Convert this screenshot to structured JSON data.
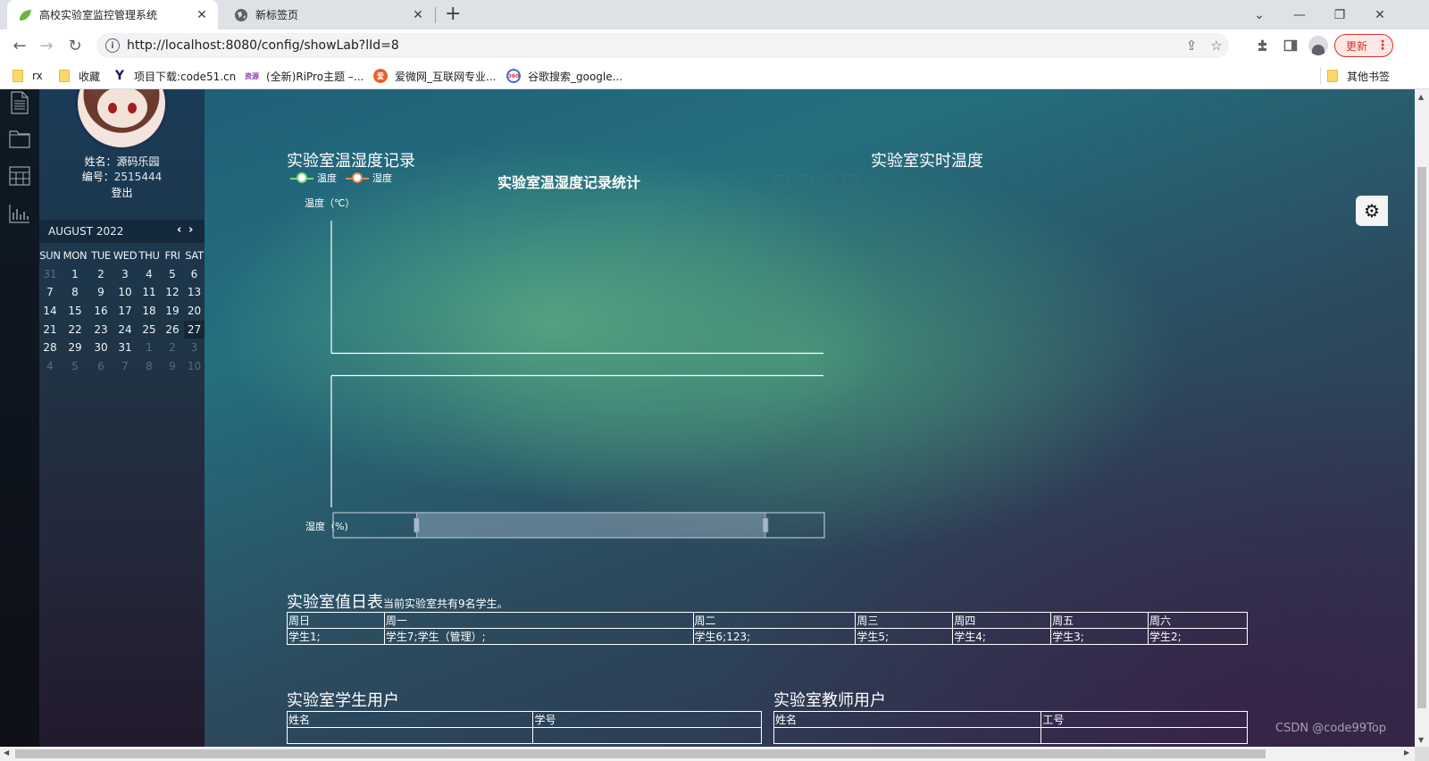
{
  "browser": {
    "tabs": [
      {
        "title": "高校实验室监控管理系统",
        "icon": "leaf-icon",
        "active": true
      },
      {
        "title": "新标签页",
        "icon": "globe-icon",
        "active": false
      }
    ],
    "new_tab": "+",
    "window_controls": {
      "dropdown": "⌄",
      "minimize": "—",
      "restore": "❐",
      "close": "✕"
    },
    "url": "http://localhost:8080/config/showLab?lId=8",
    "update_label": "更新",
    "bookmarks": [
      {
        "label": "rx",
        "icon": "folder-icon"
      },
      {
        "label": "收藏",
        "icon": "folder-icon"
      },
      {
        "label": "项目下载:code51.cn",
        "icon": "y-logo-icon"
      },
      {
        "label": "(全新)RiPro主题 –...",
        "icon": "ziyuan-logo-icon"
      },
      {
        "label": "爱微网_互联网专业...",
        "icon": "aiwei-logo-icon"
      },
      {
        "label": "谷歌搜索_google...",
        "icon": "google-360-icon"
      }
    ],
    "other_bookmarks": "其他书签"
  },
  "sidebar": {
    "icons": [
      "document-icon",
      "folder-icon",
      "table-icon",
      "bar-chart-icon"
    ],
    "profile": {
      "name_label": "姓名：",
      "name": "源码乐园",
      "id_label": "编号：",
      "id": "2515444",
      "logout": "登出"
    },
    "calendar": {
      "month_label": "AUGUST 2022",
      "prev": "‹",
      "next": "›",
      "weekdays": [
        "SUN",
        "MON",
        "TUE",
        "WED",
        "THU",
        "FRI",
        "SAT"
      ],
      "today": "27",
      "weeks": [
        [
          "31",
          "1",
          "2",
          "3",
          "4",
          "5",
          "6"
        ],
        [
          "7",
          "8",
          "9",
          "10",
          "11",
          "12",
          "13"
        ],
        [
          "14",
          "15",
          "16",
          "17",
          "18",
          "19",
          "20"
        ],
        [
          "21",
          "22",
          "23",
          "24",
          "25",
          "26",
          "27"
        ],
        [
          "28",
          "29",
          "30",
          "31",
          "1",
          "2",
          "3"
        ],
        [
          "4",
          "5",
          "6",
          "7",
          "8",
          "9",
          "10"
        ]
      ]
    }
  },
  "main": {
    "records_title": "实验室温湿度记录",
    "realtime_title": "实验室实时温度",
    "colors": {
      "temp": "#7ed97e",
      "humidity": "#e0894a"
    },
    "duty": {
      "title": "实验室值日表",
      "subtitle": "当前实验室共有9名学生。",
      "headers": [
        "周日",
        "周一",
        "周二",
        "周三",
        "周四",
        "周五",
        "周六"
      ],
      "row": [
        "学生1;",
        "学生7;学生（管理）;",
        "学生6;123;",
        "学生5;",
        "学生4;",
        "学生3;",
        "学生2;"
      ]
    },
    "students": {
      "title": "实验室学生用户",
      "headers": [
        "姓名",
        "学号"
      ]
    },
    "teachers": {
      "title": "实验室教师用户",
      "headers": [
        "姓名",
        "工号"
      ]
    },
    "watermark": "CSDN @code99Top"
  },
  "chart_data": {
    "type": "line",
    "title": "实验室温湿度记录统计",
    "legend": [
      "温度",
      "湿度"
    ],
    "legend_position": "top-left",
    "series": [
      {
        "name": "温度",
        "values": []
      },
      {
        "name": "湿度",
        "values": []
      }
    ],
    "x": [],
    "ylabel_top": "温度（℃）",
    "ylabel_bottom": "湿度（%)",
    "datazoom_range": [
      17,
      88
    ],
    "grid": false,
    "toolbox": [
      "zoom-icon",
      "zoom-reset-icon",
      "restore-icon",
      "save-image-icon"
    ]
  }
}
